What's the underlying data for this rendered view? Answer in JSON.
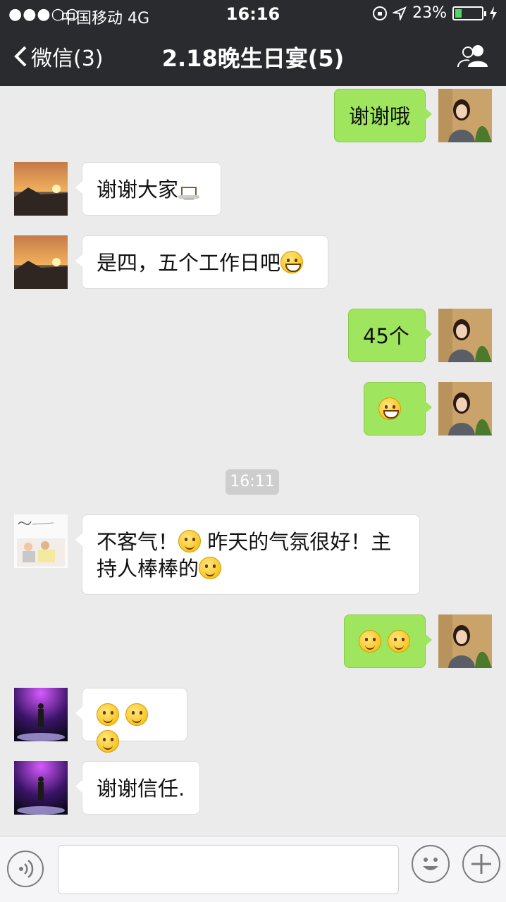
{
  "status_bar": {
    "signal": "●●●○○",
    "carrier": "中国移动  4G",
    "time": "16:16",
    "battery": "23%"
  },
  "nav": {
    "back_label": "微信(3)",
    "title": "2.18晚生日宴(5)"
  },
  "messages": [
    {
      "side": "right",
      "text": "谢谢哦"
    },
    {
      "side": "left",
      "text": "谢谢大家",
      "emoji": "coffee"
    },
    {
      "side": "left",
      "text": "是四，五个工作日吧",
      "emoji": "grin"
    },
    {
      "side": "right",
      "text": "45个"
    },
    {
      "side": "right",
      "emoji": "grin"
    },
    {
      "side": "left",
      "text_a": "不客气！",
      "text_b": " 昨天的气氛很好！主",
      "text_c": "持人棒棒的"
    },
    {
      "side": "right",
      "emoji": "smile-x2"
    },
    {
      "side": "left",
      "emoji": "blush-x3"
    },
    {
      "side": "left",
      "text": "谢谢信任."
    }
  ],
  "timestamp": "16:11",
  "colors": {
    "navbar": "#2a2b2f",
    "background": "#ebebeb",
    "bubble_right": "#9fe65e",
    "bubble_left": "#ffffff"
  },
  "icons": [
    "back-chevron-icon",
    "group-members-icon",
    "voice-icon",
    "emoji-icon",
    "plus-icon"
  ]
}
